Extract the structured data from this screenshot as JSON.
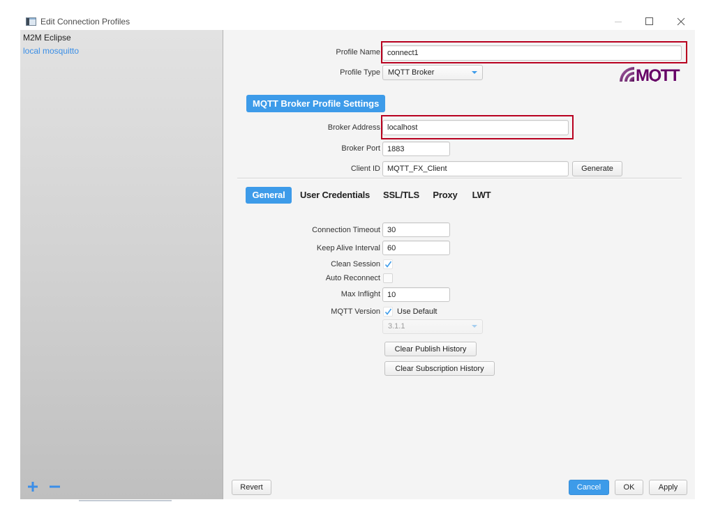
{
  "window": {
    "title": "Edit Connection Profiles",
    "icon": "app-window-icon",
    "controls": [
      "minimize-icon",
      "maximize-icon",
      "close-icon"
    ]
  },
  "sidebar": {
    "profiles": [
      {
        "label": "M2M Eclipse",
        "selected": false
      },
      {
        "label": "local mosquitto",
        "selected": true
      }
    ],
    "add_icon": "plus-icon",
    "remove_icon": "minus-icon"
  },
  "profile": {
    "name_label": "Profile Name",
    "name_value": "connect1",
    "type_label": "Profile Type",
    "type_value": "MQTT Broker",
    "type_dropdown_icon": "chevron-down-icon"
  },
  "logo": {
    "text": "MQTT"
  },
  "broker_settings": {
    "header": "MQTT Broker Profile Settings",
    "address_label": "Broker Address",
    "address_value": "localhost",
    "port_label": "Broker Port",
    "port_value": "1883",
    "client_id_label": "Client ID",
    "client_id_value": "MQTT_FX_Client",
    "generate_label": "Generate"
  },
  "tabs": [
    {
      "label": "General",
      "selected": true
    },
    {
      "label": "User Credentials",
      "selected": false
    },
    {
      "label": "SSL/TLS",
      "selected": false
    },
    {
      "label": "Proxy",
      "selected": false
    },
    {
      "label": "LWT",
      "selected": false
    }
  ],
  "general": {
    "connection_timeout_label": "Connection Timeout",
    "connection_timeout_value": "30",
    "keep_alive_label": "Keep Alive Interval",
    "keep_alive_value": "60",
    "clean_session_label": "Clean Session",
    "clean_session_checked": true,
    "auto_reconnect_label": "Auto Reconnect",
    "auto_reconnect_checked": false,
    "max_inflight_label": "Max Inflight",
    "max_inflight_value": "10",
    "mqtt_version_label": "MQTT Version",
    "use_default_label": "Use Default",
    "use_default_checked": true,
    "version_value": "3.1.1",
    "version_disabled": true,
    "clear_publish_label": "Clear Publish History",
    "clear_subscription_label": "Clear Subscription History"
  },
  "footer": {
    "revert_label": "Revert",
    "cancel_label": "Cancel",
    "ok_label": "OK",
    "apply_label": "Apply"
  },
  "colors": {
    "accent": "#3d9be9",
    "selected_profile_text": "#3a8ee6",
    "highlight_box": "#b8001f",
    "logo": "#660066",
    "sidebar_icon": "#3b8ee8"
  }
}
